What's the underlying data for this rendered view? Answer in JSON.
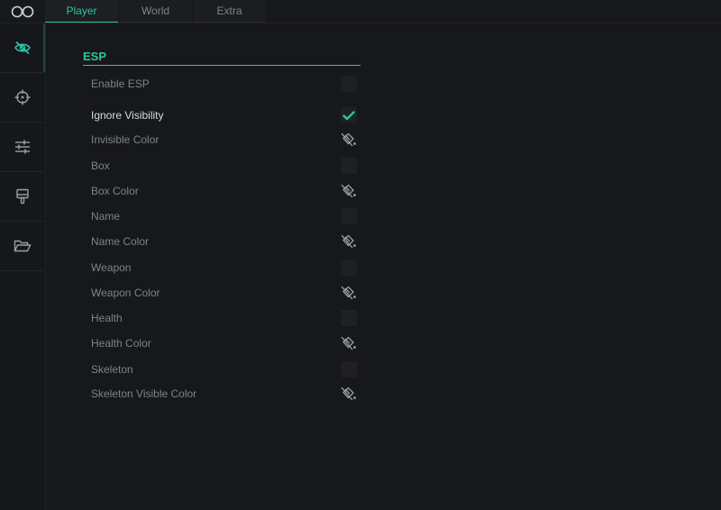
{
  "tabs": [
    {
      "label": "Player",
      "active": true
    },
    {
      "label": "World",
      "active": false
    },
    {
      "label": "Extra",
      "active": false
    }
  ],
  "sidebar": {
    "items": [
      {
        "icon": "eye-off-icon",
        "active": true
      },
      {
        "icon": "crosshair-icon",
        "active": false
      },
      {
        "icon": "sliders-icon",
        "active": false
      },
      {
        "icon": "paint-brush-icon",
        "active": false
      },
      {
        "icon": "folder-open-icon",
        "active": false
      }
    ]
  },
  "accent_color": "#2ec4a4",
  "section": {
    "title": "ESP",
    "rows": [
      {
        "label": "Enable ESP",
        "control": "checkbox",
        "checked": false
      },
      {
        "label": "Ignore Visibility",
        "control": "checkbox",
        "checked": true
      },
      {
        "label": "Invisible Color",
        "control": "color"
      },
      {
        "label": "Box",
        "control": "checkbox",
        "checked": false
      },
      {
        "label": "Box Color",
        "control": "color"
      },
      {
        "label": "Name",
        "control": "checkbox",
        "checked": false
      },
      {
        "label": "Name Color",
        "control": "color"
      },
      {
        "label": "Weapon",
        "control": "checkbox",
        "checked": false
      },
      {
        "label": "Weapon Color",
        "control": "color"
      },
      {
        "label": "Health",
        "control": "checkbox",
        "checked": false
      },
      {
        "label": "Health Color",
        "control": "color"
      },
      {
        "label": "Skeleton",
        "control": "checkbox",
        "checked": false
      },
      {
        "label": "Skeleton Visible Color",
        "control": "color"
      }
    ]
  }
}
